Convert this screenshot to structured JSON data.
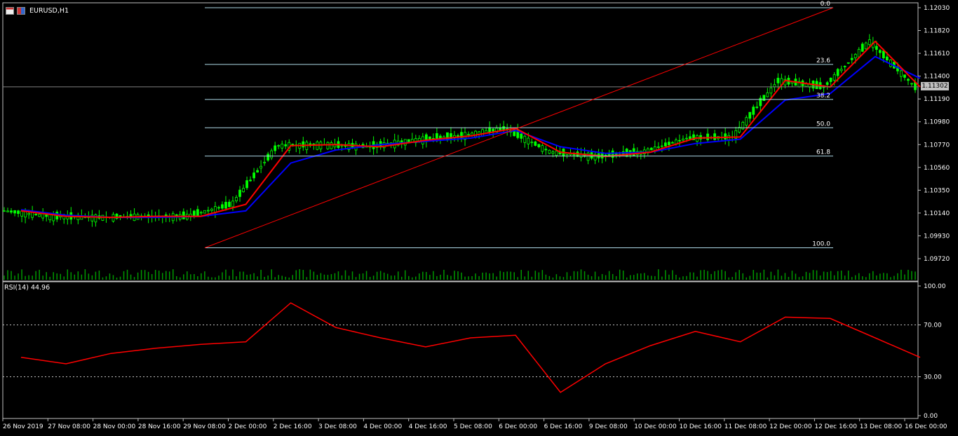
{
  "window": {
    "symbol_title": "EURUSD,H1"
  },
  "price_panel": {
    "y_ticks": [
      "1.12030",
      "1.11820",
      "1.11610",
      "1.11400",
      "1.11190",
      "1.10980",
      "1.10770",
      "1.10560",
      "1.10350",
      "1.10140",
      "1.09930",
      "1.09720"
    ],
    "current_price": "1.11302",
    "fib_levels": [
      "0.0",
      "23.6",
      "38.2",
      "50.0",
      "61.8",
      "100.0"
    ]
  },
  "rsi_panel": {
    "label": "RSI(14) 44.96",
    "y_ticks": [
      "100.00",
      "70.00",
      "30.00",
      "0.00"
    ]
  },
  "x_ticks": [
    "26 Nov 2019",
    "27 Nov 08:00",
    "28 Nov 00:00",
    "28 Nov 16:00",
    "29 Nov 08:00",
    "2 Dec 00:00",
    "2 Dec 16:00",
    "3 Dec 08:00",
    "4 Dec 00:00",
    "4 Dec 16:00",
    "5 Dec 08:00",
    "6 Dec 00:00",
    "6 Dec 16:00",
    "9 Dec 08:00",
    "10 Dec 00:00",
    "10 Dec 16:00",
    "11 Dec 08:00",
    "12 Dec 00:00",
    "12 Dec 16:00",
    "13 Dec 08:00",
    "16 Dec 00:00"
  ],
  "colors": {
    "candles": "#00ff00",
    "ma_fast": "#ff0000",
    "ma_slow": "#0000ff",
    "fib": "#add8e6",
    "rsi": "#ff0000",
    "trend": "#ff0000"
  },
  "chart_data": [
    {
      "type": "line",
      "title": "EURUSD,H1",
      "ylim": [
        1.0972,
        1.1203
      ],
      "grid": false,
      "x": [
        "26 Nov 2019",
        "27 Nov 08:00",
        "28 Nov 00:00",
        "28 Nov 16:00",
        "29 Nov 08:00",
        "2 Dec 00:00",
        "2 Dec 16:00",
        "3 Dec 08:00",
        "4 Dec 00:00",
        "4 Dec 16:00",
        "5 Dec 08:00",
        "6 Dec 00:00",
        "6 Dec 16:00",
        "9 Dec 08:00",
        "10 Dec 00:00",
        "10 Dec 16:00",
        "11 Dec 08:00",
        "12 Dec 00:00",
        "12 Dec 16:00",
        "13 Dec 08:00",
        "16 Dec 00:00"
      ],
      "series": [
        {
          "values": [
            1.1016,
            1.1011,
            1.101,
            1.1011,
            1.1011,
            1.1022,
            1.1076,
            1.1077,
            1.1075,
            1.1081,
            1.1085,
            1.1092,
            1.107,
            1.1066,
            1.107,
            1.1083,
            1.1084,
            1.1136,
            1.113,
            1.1172,
            1.113
          ]
        },
        {
          "values": [
            1.1017,
            1.1012,
            1.101,
            1.101,
            1.1011,
            1.1016,
            1.106,
            1.1072,
            1.1077,
            1.108,
            1.1083,
            1.109,
            1.1075,
            1.1069,
            1.107,
            1.1078,
            1.1082,
            1.1118,
            1.1124,
            1.1158,
            1.1138
          ]
        }
      ],
      "fibonacci": {
        "levels": [
          0.0,
          23.6,
          38.2,
          50.0,
          61.8,
          100.0
        ],
        "high": 1.1203,
        "low": 1.0982
      },
      "current_price": 1.11302
    },
    {
      "type": "line",
      "title": "RSI(14) 44.96",
      "ylim": [
        0,
        100
      ],
      "reference_lines": [
        70,
        30
      ],
      "x": [
        "26 Nov 2019",
        "27 Nov 08:00",
        "28 Nov 00:00",
        "28 Nov 16:00",
        "29 Nov 08:00",
        "2 Dec 00:00",
        "2 Dec 16:00",
        "3 Dec 08:00",
        "4 Dec 00:00",
        "4 Dec 16:00",
        "5 Dec 08:00",
        "6 Dec 00:00",
        "6 Dec 16:00",
        "9 Dec 08:00",
        "10 Dec 00:00",
        "10 Dec 16:00",
        "11 Dec 08:00",
        "12 Dec 00:00",
        "12 Dec 16:00",
        "13 Dec 08:00",
        "16 Dec 00:00"
      ],
      "series": [
        {
          "values": [
            45,
            40,
            48,
            52,
            55,
            57,
            87,
            68,
            60,
            53,
            60,
            62,
            18,
            40,
            54,
            65,
            57,
            76,
            75,
            60,
            45
          ]
        }
      ]
    }
  ]
}
